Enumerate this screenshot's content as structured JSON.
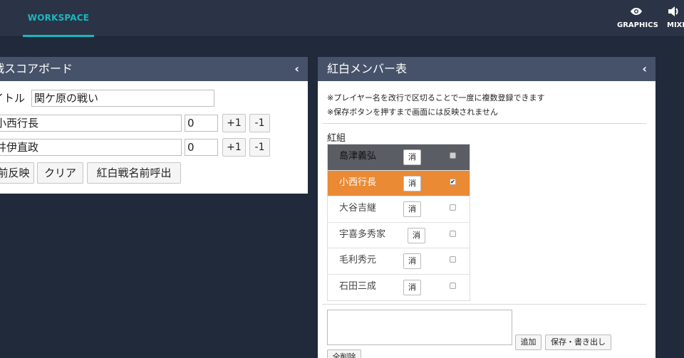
{
  "topbar": {
    "workspace_tab": "WORKSPACE",
    "graphics_label": "GRAPHICS",
    "graphics_icon": "eye-icon",
    "mixer_label": "MIXER",
    "mixer_icon": "speaker-icon",
    "accent_color": "#1ab7c0"
  },
  "score_panel": {
    "title": "戦スコアボード",
    "collapse_icon": "‹",
    "title_label": "イトル",
    "title_value": "関ケ原の戦い",
    "team1_name": "小西行長",
    "team1_score": "0",
    "team2_name": "井伊直政",
    "team2_score": "0",
    "plus_label": "+1",
    "minus_label": "-1",
    "reflect_button": "前反映",
    "clear_button": "クリア",
    "load_names_button": "紅白戦名前呼出"
  },
  "member_panel": {
    "title": "紅白メンバー表",
    "collapse_icon": "‹",
    "note1": "※プレイヤー名を改行で区切ることで一度に複数登録できます",
    "note2": "※保存ボタンを押すまで画面には反映されません",
    "group_label": "紅組",
    "delete_label": "消",
    "members": [
      {
        "name": "島津義弘",
        "checked": false,
        "state": "header"
      },
      {
        "name": "小西行長",
        "checked": true,
        "state": "selected"
      },
      {
        "name": "大谷吉継",
        "checked": false,
        "state": "normal"
      },
      {
        "name": "宇喜多秀家",
        "checked": false,
        "state": "normal"
      },
      {
        "name": "毛利秀元",
        "checked": false,
        "state": "normal"
      },
      {
        "name": "石田三成",
        "checked": false,
        "state": "normal"
      }
    ],
    "textarea_value": "",
    "add_button": "追加",
    "save_button": "保存・書き出し",
    "clear_all_button": "全削除",
    "selected_color": "#ea8a35"
  }
}
